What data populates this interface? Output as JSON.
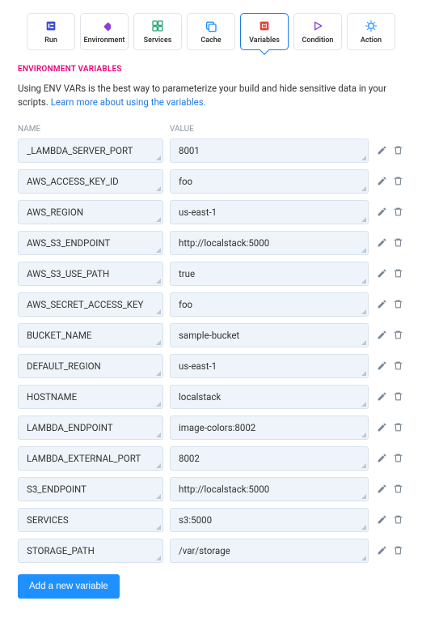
{
  "tabs": [
    {
      "id": "run",
      "label": "Run"
    },
    {
      "id": "environment",
      "label": "Environment"
    },
    {
      "id": "services",
      "label": "Services"
    },
    {
      "id": "cache",
      "label": "Cache"
    },
    {
      "id": "variables",
      "label": "Variables",
      "active": true
    },
    {
      "id": "condition",
      "label": "Condition"
    },
    {
      "id": "action",
      "label": "Action"
    }
  ],
  "section_title": "ENVIRONMENT VARIABLES",
  "description_text": "Using ENV VARs is the best way to parameterize your build and hide sensitive data in your scripts. ",
  "description_link": "Learn more about using the variables.",
  "columns": {
    "name": "NAME",
    "value": "VALUE"
  },
  "vars": [
    {
      "name": "_LAMBDA_SERVER_PORT",
      "value": "8001"
    },
    {
      "name": "AWS_ACCESS_KEY_ID",
      "value": "foo"
    },
    {
      "name": "AWS_REGION",
      "value": "us-east-1"
    },
    {
      "name": "AWS_S3_ENDPOINT",
      "value": "http://localstack:5000"
    },
    {
      "name": "AWS_S3_USE_PATH",
      "value": "true"
    },
    {
      "name": "AWS_SECRET_ACCESS_KEY",
      "value": "foo"
    },
    {
      "name": "BUCKET_NAME",
      "value": "sample-bucket"
    },
    {
      "name": "DEFAULT_REGION",
      "value": "us-east-1"
    },
    {
      "name": "HOSTNAME",
      "value": "localstack"
    },
    {
      "name": "LAMBDA_ENDPOINT",
      "value": "image-colors:8002"
    },
    {
      "name": "LAMBDA_EXTERNAL_PORT",
      "value": "8002"
    },
    {
      "name": "S3_ENDPOINT",
      "value": "http://localstack:5000"
    },
    {
      "name": "SERVICES",
      "value": "s3:5000"
    },
    {
      "name": "STORAGE_PATH",
      "value": "/var/storage"
    }
  ],
  "add_button_label": "Add a new variable",
  "icons": {
    "edit": "pencil-icon",
    "delete": "trash-icon"
  }
}
